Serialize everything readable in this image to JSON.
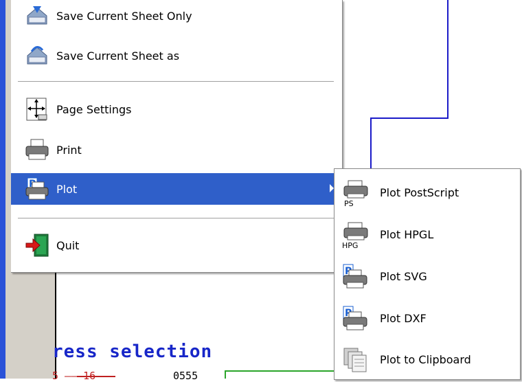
{
  "file_menu": {
    "items": [
      {
        "label": "Save Current Sheet Only",
        "icon": "save-disk-icon"
      },
      {
        "label": "Save Current Sheet as",
        "icon": "save-as-icon"
      },
      {
        "label": "Page Settings",
        "icon": "page-settings-icon"
      },
      {
        "label": "Print",
        "icon": "printer-icon"
      },
      {
        "label": "Plot",
        "icon": "plot-printer-icon",
        "highlighted": true,
        "has_submenu": true
      },
      {
        "label": "Quit",
        "icon": "quit-door-icon"
      }
    ]
  },
  "plot_submenu": {
    "items": [
      {
        "label": "Plot PostScript",
        "icon": "postscript-printer-icon",
        "badge": "PS"
      },
      {
        "label": "Plot HPGL",
        "icon": "hpgl-printer-icon",
        "badge": "HPG"
      },
      {
        "label": "Plot SVG",
        "icon": "svg-printer-icon"
      },
      {
        "label": "Plot DXF",
        "icon": "dxf-printer-icon"
      },
      {
        "label": "Plot to Clipboard",
        "icon": "clipboard-pages-icon"
      }
    ]
  },
  "canvas": {
    "status_text": "ress selection",
    "bottom_red_text": "5 —— 16",
    "bottom_black_text": "0555"
  },
  "colors": {
    "highlight": "#2f5fc9",
    "wire": "#1a1ac8",
    "status_text": "#1726c8",
    "gutter": "#d4d0c8",
    "left_strip": "#2a52d8"
  }
}
